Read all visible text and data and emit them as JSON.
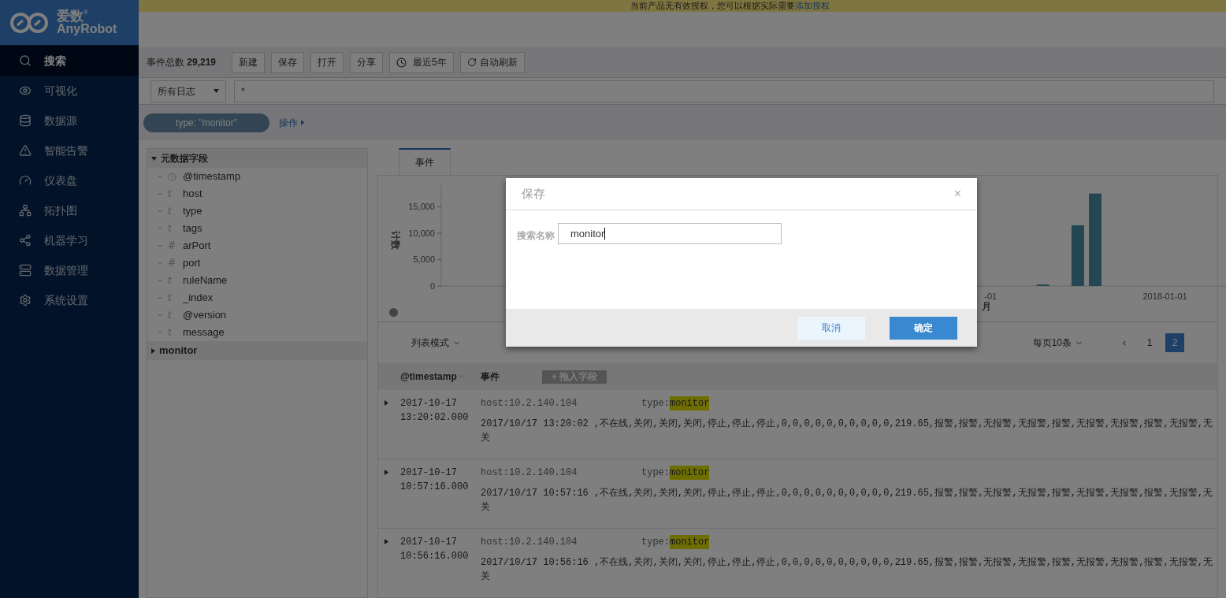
{
  "banner": {
    "text": "当前产品无有效授权，您可以根据实际需要",
    "link": "添加授权"
  },
  "logo": {
    "name": "爱数",
    "sub": "AnyRobot",
    "mark": "®"
  },
  "nav": [
    {
      "label": "搜索",
      "selected": true
    },
    {
      "label": "可视化",
      "selected": false
    },
    {
      "label": "数据源",
      "selected": false
    },
    {
      "label": "智能告警",
      "selected": false
    },
    {
      "label": "仪表盘",
      "selected": false
    },
    {
      "label": "拓扑图",
      "selected": false
    },
    {
      "label": "机器学习",
      "selected": false
    },
    {
      "label": "数据管理",
      "selected": false
    },
    {
      "label": "系统设置",
      "selected": false
    }
  ],
  "toolbar": {
    "count_label": "事件总数",
    "count": "29,219",
    "buttons": [
      "新建",
      "保存",
      "打开",
      "分享",
      "最近5年",
      "自动刷新"
    ]
  },
  "query": {
    "source": "所有日志",
    "value": "*"
  },
  "filter": {
    "chip": "type: \"monitor\"",
    "actions": "操作"
  },
  "fields": {
    "groups": [
      {
        "label": "元数据字段",
        "expanded": true,
        "children": [
          {
            "name": "@timestamp",
            "kind": "date"
          },
          {
            "name": "host",
            "kind": "text",
            "mark": "t"
          },
          {
            "name": "type",
            "kind": "text",
            "mark": "t"
          },
          {
            "name": "tags",
            "kind": "text",
            "mark": "t"
          },
          {
            "name": "arPort",
            "kind": "number",
            "mark": "#"
          },
          {
            "name": "port",
            "kind": "number",
            "mark": "#"
          },
          {
            "name": "ruleName",
            "kind": "text",
            "mark": "t"
          },
          {
            "name": "_index",
            "kind": "text",
            "mark": "t"
          },
          {
            "name": "@version",
            "kind": "text",
            "mark": "t"
          },
          {
            "name": "message",
            "kind": "text",
            "mark": "t"
          }
        ]
      },
      {
        "label": "monitor",
        "expanded": false
      }
    ]
  },
  "tabs": [
    {
      "label": "事件",
      "selected": true
    }
  ],
  "chart": {
    "x_labels": [
      "-01",
      "2018-01-01"
    ],
    "chart_data": {
      "type": "bar",
      "xlabel": "月",
      "ylabel": "计数",
      "ylim": [
        0,
        17600
      ],
      "yticks": [
        {
          "value": 0,
          "label": "0"
        },
        {
          "value": 5000,
          "label": "5,000"
        },
        {
          "value": 10000,
          "label": "10,000"
        },
        {
          "value": 15000,
          "label": "15,000"
        }
      ],
      "series": [
        {
          "color": "#4a8fa8",
          "values": [
            null,
            null,
            null,
            null,
            null,
            null,
            null,
            null,
            null,
            null,
            null,
            null,
            null,
            null,
            null,
            null,
            null,
            null,
            null,
            null,
            null,
            null,
            null,
            null,
            null,
            null,
            null,
            null,
            null,
            null,
            null,
            null,
            null,
            null,
            300,
            null,
            11500,
            17500,
            null,
            null,
            null,
            null,
            null,
            null,
            null
          ]
        }
      ]
    }
  },
  "list": {
    "mode": "列表模式",
    "per_page": "每页10条",
    "pages": [
      {
        "label": "‹",
        "selected": false
      },
      {
        "label": "1",
        "selected": false
      },
      {
        "label": "2",
        "selected": true
      }
    ],
    "columns": [
      {
        "label": "@timestamp",
        "sortable": true
      },
      {
        "label": "事件",
        "sortable": false
      }
    ],
    "add_field": "+ 拖入字段",
    "rows": [
      {
        "date": "2017-10-17",
        "time": "13:20:02.000",
        "host": "host:10.2.140.104",
        "type_key": "type:",
        "type_value": "monitor",
        "message": "2017/10/17 13:20:02 ,不在线,关闭,关闭,关闭,停止,停止,停止,0,0,0,0,0,0,0,0,0,0,219.65,报警,报警,无报警,无报警,报警,无报警,无报警,报警,无报警,无",
        "message_continued": "关"
      },
      {
        "date": "2017-10-17",
        "time": "10:57:16.000",
        "host": "host:10.2.140.104",
        "type_key": "type:",
        "type_value": "monitor",
        "message": "2017/10/17 10:57:16 ,不在线,关闭,关闭,关闭,停止,停止,停止,0,0,0,0,0,0,0,0,0,0,219.65,报警,报警,无报警,无报警,报警,无报警,无报警,报警,无报警,无",
        "message_continued": "关"
      },
      {
        "date": "2017-10-17",
        "time": "10:56:16.000",
        "host": "host:10.2.140.104",
        "type_key": "type:",
        "type_value": "monitor",
        "message": "2017/10/17 10:56:16 ,不在线,关闭,关闭,关闭,停止,停止,停止,0,0,0,0,0,0,0,0,0,0,219.65,报警,报警,无报警,无报警,报警,无报警,无报警,报警,无报警,无",
        "message_continued": "关"
      }
    ]
  },
  "dialog": {
    "title": "保存",
    "close": "×",
    "field_label": "搜索名称",
    "value": "monitor",
    "cancel": "取消",
    "confirm": "确定"
  }
}
